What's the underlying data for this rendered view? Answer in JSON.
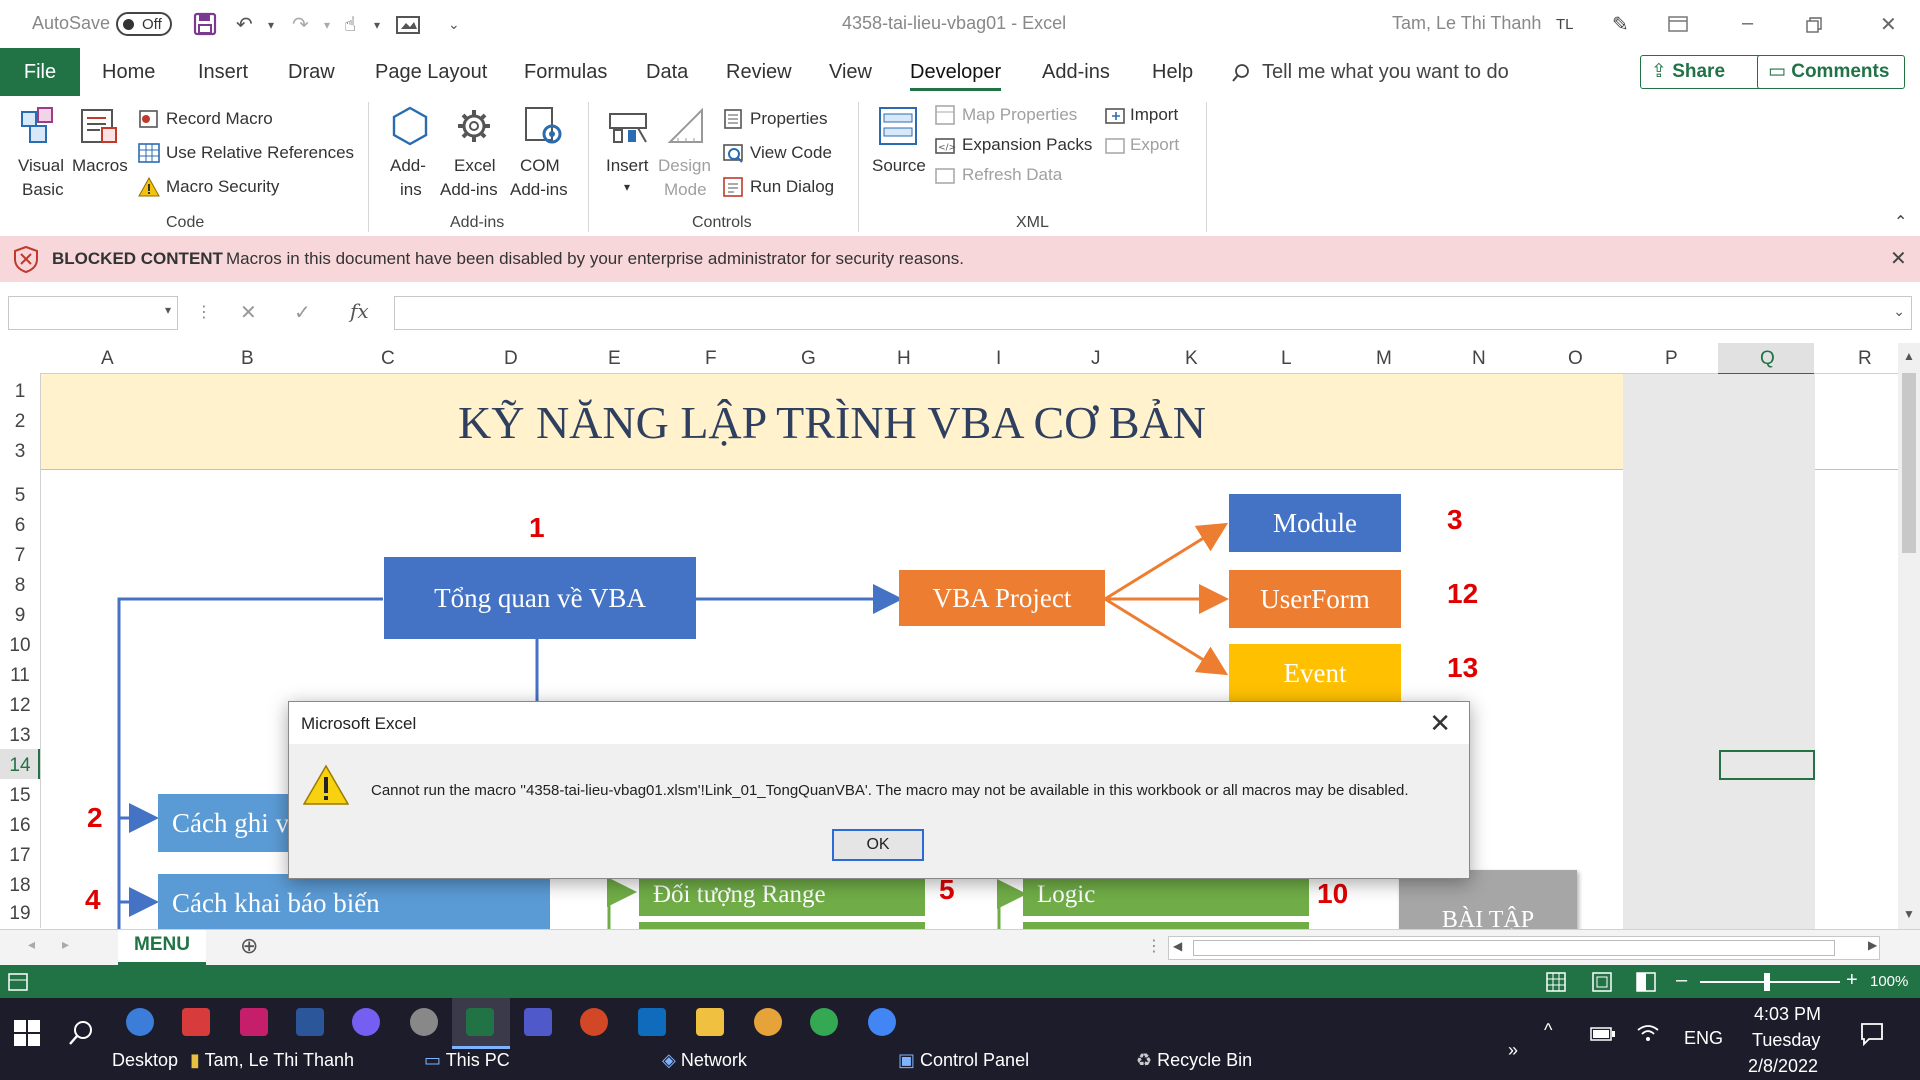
{
  "titlebar": {
    "autosave_label": "AutoSave",
    "autosave_state": "Off",
    "doc_title": "4358-tai-lieu-vbag01 - Excel",
    "user_name": "Tam, Le Thi Thanh",
    "user_initials": "TL"
  },
  "tabs": {
    "file": "File",
    "items": [
      "Home",
      "Insert",
      "Draw",
      "Page Layout",
      "Formulas",
      "Data",
      "Review",
      "View",
      "Developer",
      "Add-ins",
      "Help"
    ],
    "active": "Developer",
    "tell_me": "Tell me what you want to do",
    "share": "Share",
    "comments": "Comments"
  },
  "ribbon": {
    "code": {
      "group": "Code",
      "visual_basic_1": "Visual",
      "visual_basic_2": "Basic",
      "macros": "Macros",
      "record_macro": "Record Macro",
      "relative_refs": "Use Relative References",
      "macro_security": "Macro Security"
    },
    "addins": {
      "group": "Add-ins",
      "addins_1": "Add-",
      "addins_2": "ins",
      "excel_addins_1": "Excel",
      "excel_addins_2": "Add-ins",
      "com_addins_1": "COM",
      "com_addins_2": "Add-ins"
    },
    "controls": {
      "group": "Controls",
      "insert": "Insert",
      "design_mode_1": "Design",
      "design_mode_2": "Mode",
      "properties": "Properties",
      "view_code": "View Code",
      "run_dialog": "Run Dialog"
    },
    "xml": {
      "group": "XML",
      "source": "Source",
      "map_properties": "Map Properties",
      "expansion_packs": "Expansion Packs",
      "refresh_data": "Refresh Data",
      "import": "Import",
      "export": "Export"
    }
  },
  "blocked": {
    "label": "BLOCKED CONTENT",
    "message": "Macros in this document have been disabled by your enterprise administrator for security reasons."
  },
  "formula_bar": {
    "name_box": "",
    "formula": "",
    "fx": "fx"
  },
  "columns": [
    "A",
    "B",
    "C",
    "D",
    "E",
    "F",
    "G",
    "H",
    "I",
    "J",
    "K",
    "L",
    "M",
    "N",
    "O",
    "P",
    "Q",
    "R"
  ],
  "active_column": "Q",
  "rows": [
    "1",
    "2",
    "3",
    "5",
    "6",
    "7",
    "8",
    "9",
    "10",
    "11",
    "12",
    "13",
    "14",
    "15",
    "16",
    "17",
    "18",
    "19"
  ],
  "active_row": "14",
  "sheet": {
    "title": "KỸ NĂNG LẬP TRÌNH VBA CƠ BẢN",
    "boxes": {
      "tong_quan": "Tổng quan về VBA",
      "vba_project": "VBA Project",
      "module": "Module",
      "userform": "UserForm",
      "event": "Event",
      "cach_ghi": "Cách ghi v",
      "cach_khai_bao": "Cách khai báo biến",
      "doi_tuong_range": "Đối tượng Range",
      "logic": "Logic",
      "bai_tap": "BÀI TẬP"
    },
    "numbers": {
      "n1": "1",
      "n3": "3",
      "n12": "12",
      "n13": "13",
      "n2": "2",
      "n4": "4",
      "n5": "5",
      "n10": "10"
    },
    "colors": {
      "blue_dark": "#4472c4",
      "blue_light": "#5b9bd5",
      "orange": "#ed7d31",
      "gold": "#ffc000",
      "green": "#70ad47",
      "grey": "#a6a6a6",
      "red_numbers": "#e00000"
    }
  },
  "dialog": {
    "title": "Microsoft Excel",
    "message": "Cannot run the macro ''4358-tai-lieu-vbag01.xlsm'!Link_01_TongQuanVBA'. The macro may not be available in this workbook or all macros may be disabled.",
    "ok": "OK",
    "icon": "warning-icon"
  },
  "sheet_tabs": {
    "active": "MENU"
  },
  "status": {
    "zoom": "100%"
  },
  "taskbar": {
    "desktop": "Desktop",
    "user": "Tam, Le Thi Thanh",
    "this_pc": "This PC",
    "network": "Network",
    "control_panel": "Control Panel",
    "recycle_bin": "Recycle Bin",
    "lang": "ENG",
    "time": "4:03 PM",
    "day": "Tuesday",
    "date": "2/8/2022"
  }
}
